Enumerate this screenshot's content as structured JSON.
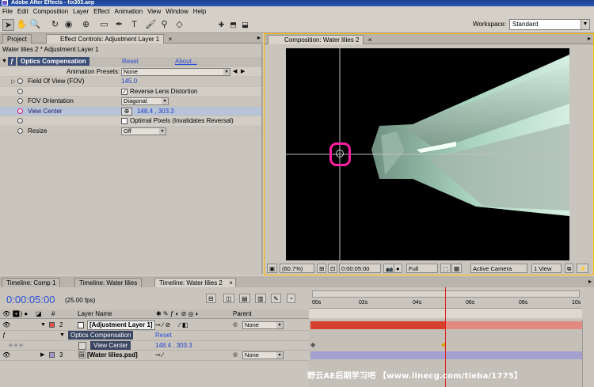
{
  "window": {
    "title": "Adobe After Effects - fix303.aep"
  },
  "menu": [
    "File",
    "Edit",
    "Composition",
    "Layer",
    "Effect",
    "Animation",
    "View",
    "Window",
    "Help"
  ],
  "toolbar": {
    "workspace_label": "Workspace:",
    "workspace_value": "Standard",
    "tools": [
      "selection-tool",
      "hand-tool",
      "zoom-tool",
      "rotate-tool",
      "orbit-camera-tool",
      "pan-behind-tool",
      "rectangle-mask-tool",
      "pen-tool",
      "text-tool",
      "brush-tool",
      "clone-stamp-tool",
      "eraser-tool"
    ]
  },
  "left_panel": {
    "tabs": [
      "Project",
      "Effect Controls: Adjustment Layer 1"
    ],
    "breadcrumb": "Water lilies 2 * Adjustment Layer 1",
    "effect": {
      "name": "Optics Compensation",
      "reset": "Reset",
      "about": "About...",
      "presets_label": "Animation Presets:",
      "presets_value": "None",
      "params": [
        {
          "label": "Field Of View (FOV)",
          "value": "145.0"
        },
        {
          "label": "",
          "value": "Reverse Lens Distortion",
          "checked": true
        },
        {
          "label": "FOV Orientation",
          "value": "Diagonal"
        },
        {
          "label": "View Center",
          "value": "148.4 , 303.3"
        },
        {
          "label": "",
          "value": "Optimal Pixels (Invalidates Reversal)",
          "checked": false
        },
        {
          "label": "Resize",
          "value": "Off"
        }
      ]
    }
  },
  "comp_panel": {
    "tab": "Composition: Water lilies 2",
    "zoom": "(60.7%)",
    "timecode": "0:00:05:00",
    "resolution": "Full",
    "camera": "Active Camera",
    "views": "1 View"
  },
  "timeline": {
    "tabs": [
      "Timeline: Comp 1",
      "Timeline: Water lilies",
      "Timeline: Water lilies 2"
    ],
    "timecode": "0:00:05:00",
    "fps": "(25.00 fps)",
    "columns": {
      "num": "#",
      "layer_name": "Layer Name",
      "parent": "Parent"
    },
    "ruler_ticks": [
      "00s",
      "02s",
      "04s",
      "06s",
      "08s",
      "10s"
    ],
    "playhead_fraction": 0.5,
    "layers": [
      {
        "num": "2",
        "name": "[Adjustment Layer 1]",
        "parent": "None"
      },
      {
        "sub": "Optics Compensation",
        "value": "Reset"
      },
      {
        "sub": "View Center",
        "value": "148.4 , 303.3"
      },
      {
        "num": "3",
        "name": "[Water lilies.psd]",
        "parent": "None"
      }
    ]
  },
  "watermark": "野云AE后期学习吧 【www.linecg.com/tieba/1775】",
  "colors": {
    "accent_blue": "#2a4bd7",
    "highlight_magenta": "#ff1fa2",
    "layer_red": "#d8402e",
    "comp_border": "#ffb800"
  }
}
